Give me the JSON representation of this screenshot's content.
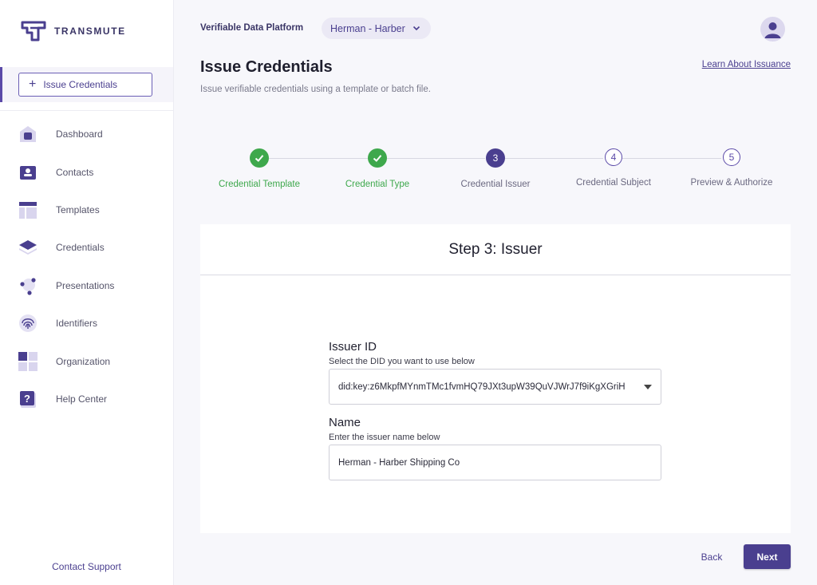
{
  "brand": {
    "name": "TRANSMUTE",
    "icon": "transmute-logo"
  },
  "sidebar": {
    "issue_button": {
      "label": "Issue Credentials",
      "icon": "plus-icon"
    },
    "items": [
      {
        "label": "Dashboard",
        "icon": "home-icon"
      },
      {
        "label": "Contacts",
        "icon": "contact-card-icon"
      },
      {
        "label": "Templates",
        "icon": "template-icon"
      },
      {
        "label": "Credentials",
        "icon": "layers-icon"
      },
      {
        "label": "Presentations",
        "icon": "nodes-icon"
      },
      {
        "label": "Identifiers",
        "icon": "fingerprint-icon"
      },
      {
        "label": "Organization",
        "icon": "grid-icon"
      },
      {
        "label": "Help Center",
        "icon": "help-icon"
      }
    ],
    "support_label": "Contact Support"
  },
  "header": {
    "platform": "Verifiable Data Platform",
    "org_selected": "Herman - Harber",
    "title": "Issue Credentials",
    "subtitle": "Issue verifiable credentials using a template or batch file.",
    "learn_link": "Learn About Issuance"
  },
  "stepper": {
    "steps": [
      {
        "label": "Credential Template",
        "status": "done",
        "number": "1"
      },
      {
        "label": "Credential Type",
        "status": "done",
        "number": "2"
      },
      {
        "label": "Credential Issuer",
        "status": "active",
        "number": "3"
      },
      {
        "label": "Credential Subject",
        "status": "todo",
        "number": "4"
      },
      {
        "label": "Preview & Authorize",
        "status": "todo",
        "number": "5"
      }
    ]
  },
  "form": {
    "heading": "Step 3: Issuer",
    "issuer_id": {
      "label": "Issuer ID",
      "help": "Select the DID you want to use below",
      "value": "did:key:z6MkpfMYnmTMc1fvmHQ79JXt3upW39QuVJWrJ7f9iKgXGriH"
    },
    "name": {
      "label": "Name",
      "help": "Enter the issuer name below",
      "value": "Herman - Harber Shipping Co"
    }
  },
  "footer": {
    "back_label": "Back",
    "next_label": "Next"
  },
  "colors": {
    "accent": "#4a3f8f",
    "success": "#3ea84c",
    "background": "#f7f7fb"
  }
}
